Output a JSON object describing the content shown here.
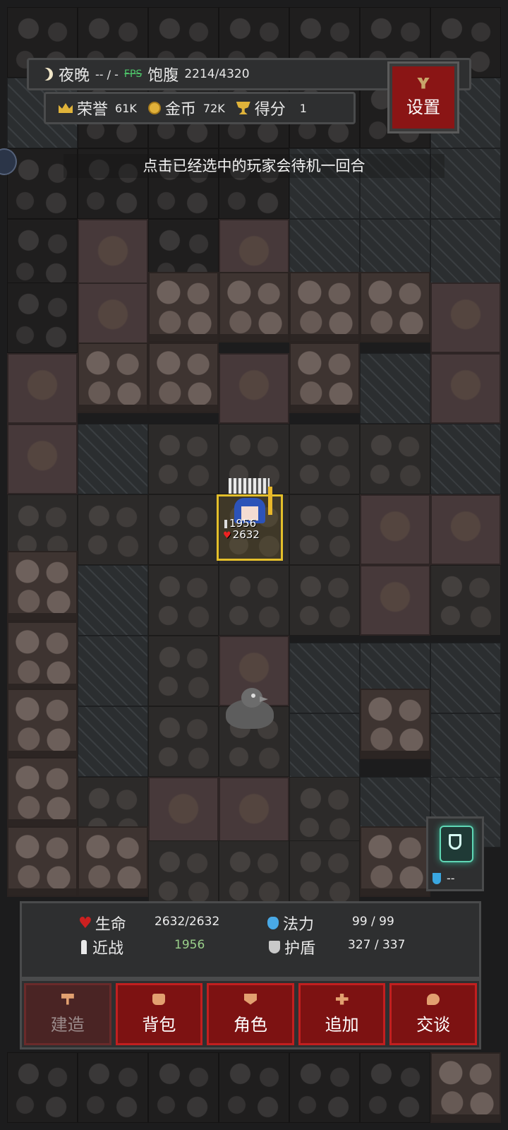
{
  "hud": {
    "time_of_day": "夜晚",
    "time_sep": "-- / -",
    "fps_label": "FPS",
    "satiety_label": "饱腹",
    "satiety_value": "2214/4320",
    "honor_label": "荣誉",
    "honor_value": "61K",
    "gold_label": "金币",
    "gold_value": "72K",
    "score_label": "得分",
    "score_value": "1",
    "settings_label": "设置"
  },
  "hint": "点击已经选中的玩家会待机一回合",
  "player": {
    "attack": "1956",
    "hp": "2632"
  },
  "quickslot": {
    "count": "--"
  },
  "stats": {
    "hp_label": "生命",
    "hp_value": "2632/2632",
    "mp_label": "法力",
    "mp_value": "99 / 99",
    "melee_label": "近战",
    "melee_value": "1956",
    "shield_label": "护盾",
    "shield_value": "327 / 337"
  },
  "buttons": {
    "build": "建造",
    "bag": "背包",
    "character": "角色",
    "add": "追加",
    "talk": "交谈"
  },
  "colors": {
    "button_red": "#7d1212",
    "frame_gold": "#e4bf2a",
    "panel_bg": "#2e2f30"
  }
}
